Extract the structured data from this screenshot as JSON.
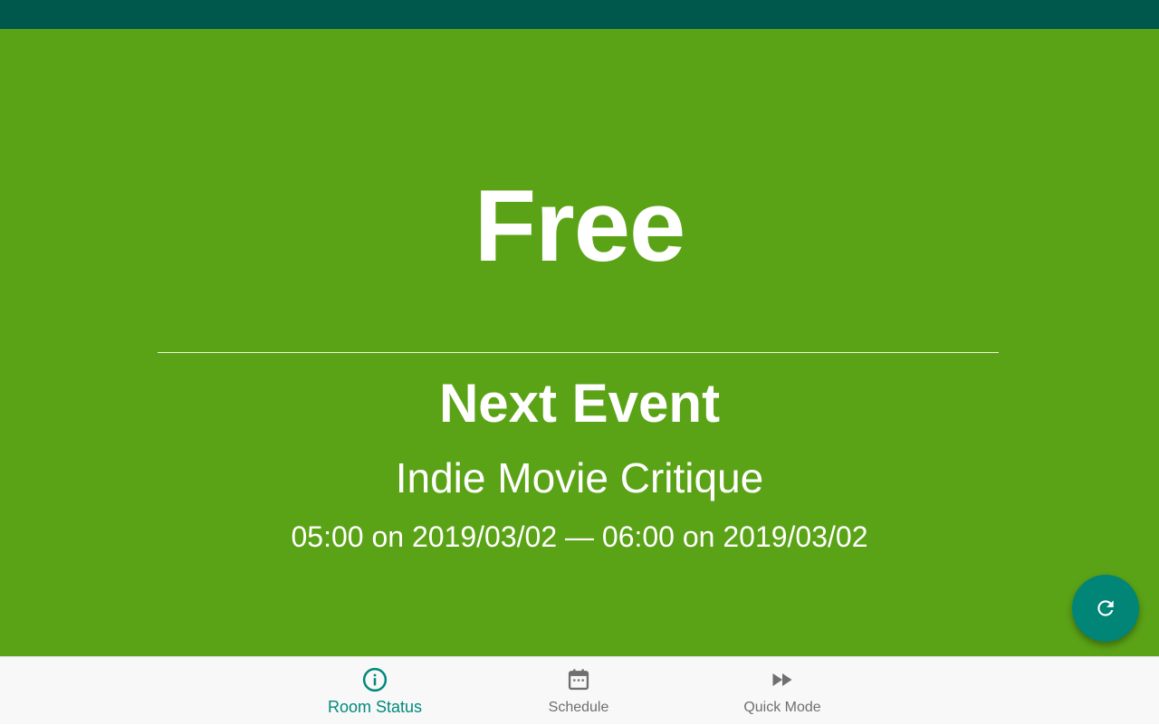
{
  "room": {
    "status": "Free",
    "next_event_heading": "Next Event",
    "next_event_title": "Indie Movie Critique",
    "next_event_time": "05:00 on 2019/03/02 — 06:00 on 2019/03/02"
  },
  "fab": {
    "icon": "refresh-icon"
  },
  "bottom_nav": {
    "items": [
      {
        "label": "Room Status",
        "icon": "info-icon",
        "active": true
      },
      {
        "label": "Schedule",
        "icon": "calendar-icon",
        "active": false
      },
      {
        "label": "Quick Mode",
        "icon": "fast-forward-icon",
        "active": false
      }
    ]
  },
  "colors": {
    "status_bar": "#00574b",
    "free_background": "#5ba316",
    "accent": "#008577",
    "nav_active": "#00897b",
    "nav_inactive": "#6f6f6f"
  }
}
